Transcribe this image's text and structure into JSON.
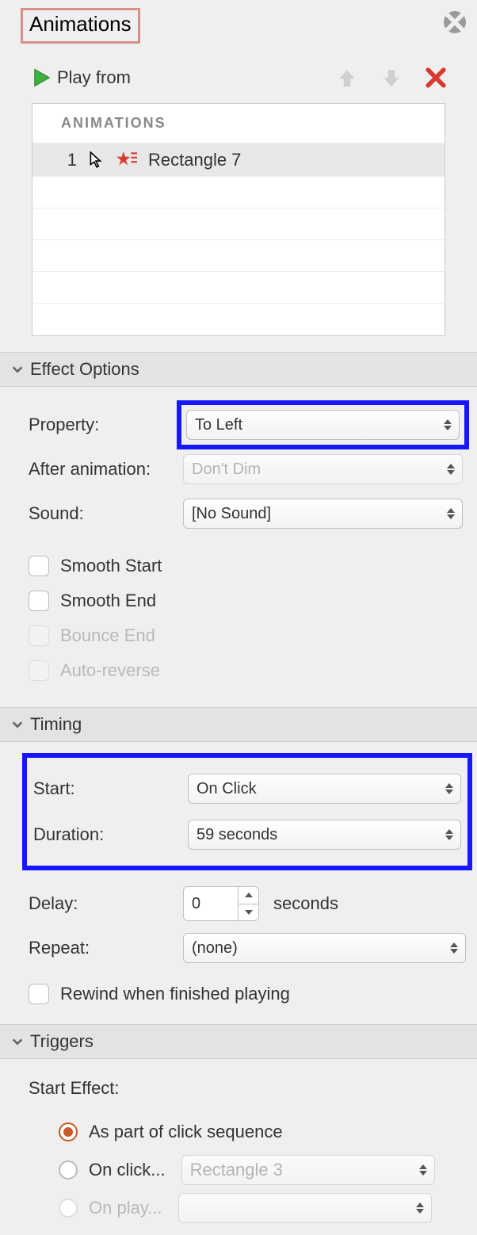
{
  "panel": {
    "title": "Animations"
  },
  "toolbar": {
    "play_label": "Play from"
  },
  "list": {
    "header": "ANIMATIONS",
    "items": [
      {
        "num": "1",
        "name": "Rectangle 7"
      }
    ]
  },
  "effect": {
    "section": "Effect Options",
    "property_label": "Property:",
    "property_value": "To Left",
    "after_label": "After animation:",
    "after_value": "Don't Dim",
    "sound_label": "Sound:",
    "sound_value": "[No Sound]",
    "smooth_start": "Smooth Start",
    "smooth_end": "Smooth End",
    "bounce_end": "Bounce End",
    "auto_reverse": "Auto-reverse"
  },
  "timing": {
    "section": "Timing",
    "start_label": "Start:",
    "start_value": "On Click",
    "duration_label": "Duration:",
    "duration_value": "59 seconds",
    "delay_label": "Delay:",
    "delay_value": "0",
    "delay_unit": "seconds",
    "repeat_label": "Repeat:",
    "repeat_value": "(none)",
    "rewind_label": "Rewind when finished playing"
  },
  "triggers": {
    "section": "Triggers",
    "title": "Start Effect:",
    "opt_seq": "As part of click sequence",
    "opt_click": "On click...",
    "click_target": "Rectangle 3",
    "opt_play": "On play..."
  }
}
